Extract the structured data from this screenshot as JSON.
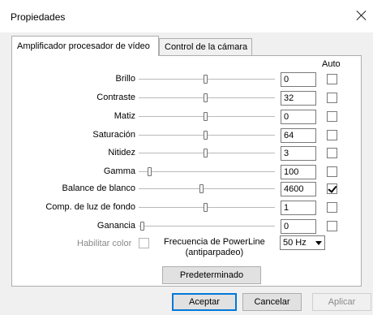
{
  "window": {
    "title": "Propiedades"
  },
  "tabs": [
    {
      "label": "Amplificador procesador de vídeo",
      "active": true
    },
    {
      "label": "Control de la cámara",
      "active": false
    }
  ],
  "auto_header": "Auto",
  "controls": [
    {
      "label": "Brillo",
      "value": "0",
      "slider_fraction": 0.49,
      "auto": false
    },
    {
      "label": "Contraste",
      "value": "32",
      "slider_fraction": 0.49,
      "auto": false
    },
    {
      "label": "Matiz",
      "value": "0",
      "slider_fraction": 0.49,
      "auto": false
    },
    {
      "label": "Saturación",
      "value": "64",
      "slider_fraction": 0.49,
      "auto": false
    },
    {
      "label": "Nitidez",
      "value": "3",
      "slider_fraction": 0.49,
      "auto": false
    },
    {
      "label": "Gamma",
      "value": "100",
      "slider_fraction": 0.07,
      "auto": false
    },
    {
      "label": "Balance de blanco",
      "value": "4600",
      "slider_fraction": 0.46,
      "auto": true
    },
    {
      "label": "Comp. de luz de fondo",
      "value": "1",
      "slider_fraction": 0.49,
      "auto": false
    },
    {
      "label": "Ganancia",
      "value": "0",
      "slider_fraction": 0.01,
      "auto": false
    }
  ],
  "enable_color": {
    "label": "Habilitar color",
    "checked": false,
    "enabled": false
  },
  "powerline": {
    "label_line1": "Frecuencia de PowerLine",
    "label_line2": "(antiparpadeo)",
    "selected": "50 Hz"
  },
  "buttons": {
    "default_label": "Predeterminado",
    "ok_label": "Aceptar",
    "cancel_label": "Cancelar",
    "apply_label": "Aplicar"
  },
  "icons": {
    "close": "close-icon",
    "dropdown": "chevron-down-icon"
  }
}
